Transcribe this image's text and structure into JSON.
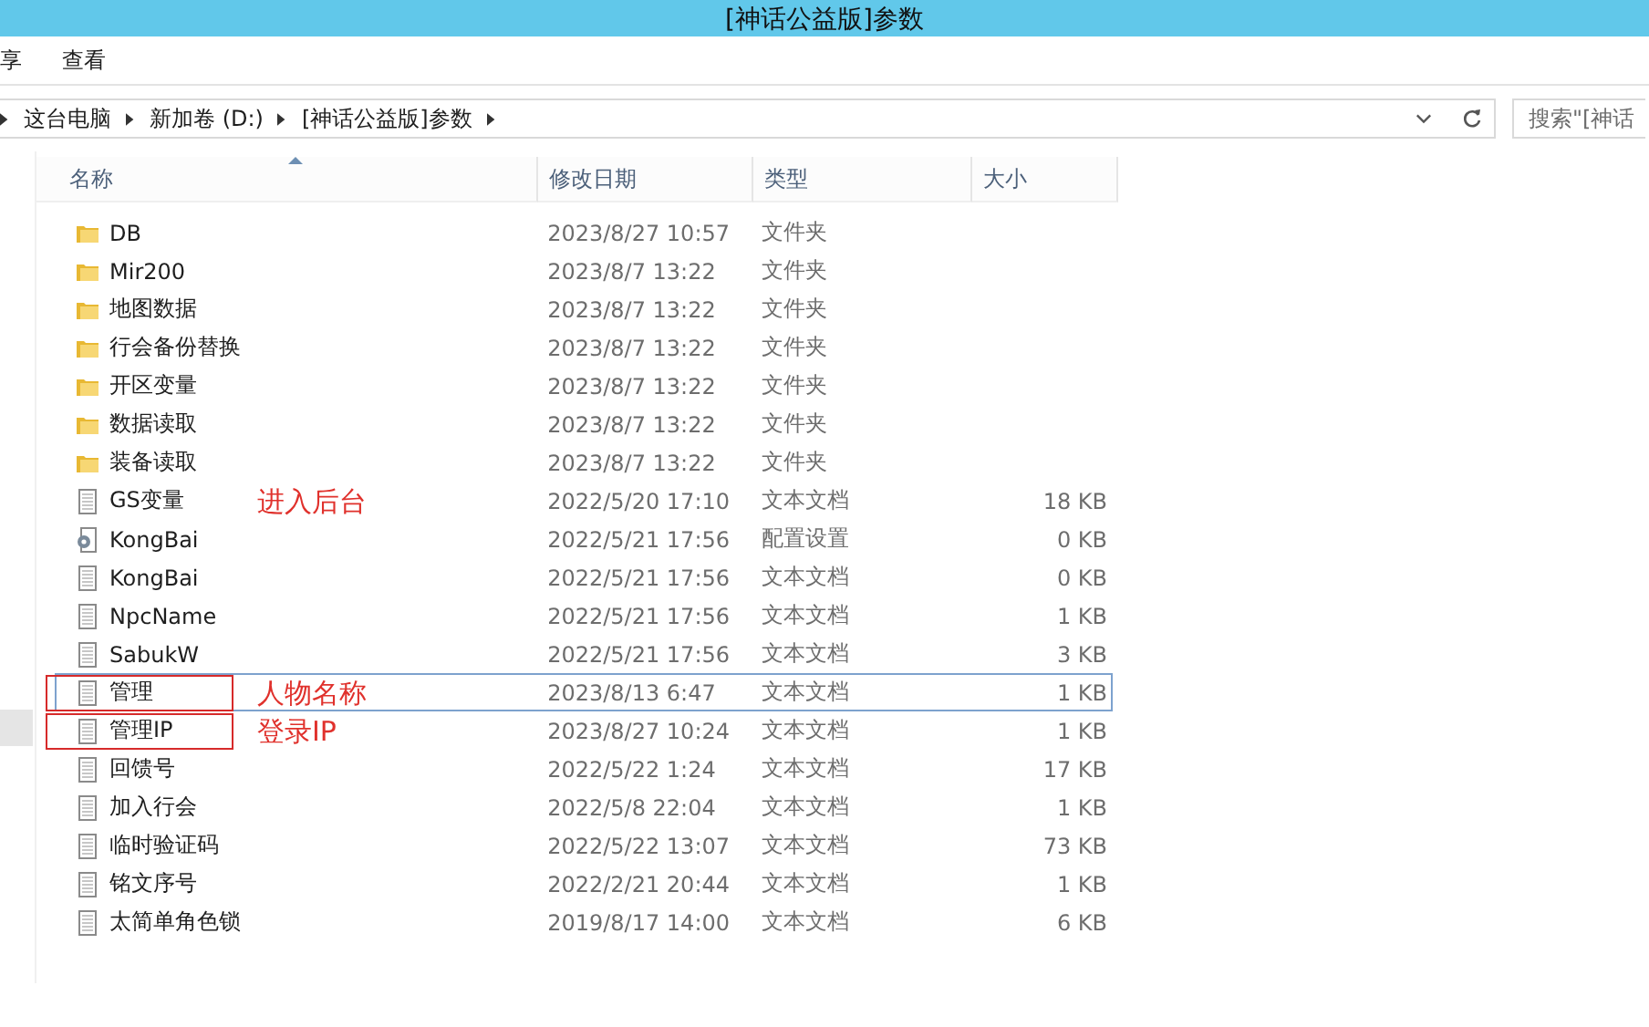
{
  "window": {
    "title": "[神话公益版]参数"
  },
  "menu": [
    {
      "label": "享"
    },
    {
      "label": "查看"
    }
  ],
  "address": {
    "crumbs": [
      "这台电脑",
      "新加卷 (D:)",
      "[神话公益版]参数"
    ]
  },
  "search": {
    "placeholder": "搜索\"[神话"
  },
  "table": {
    "columns": [
      "名称",
      "修改日期",
      "类型",
      "大小"
    ],
    "rows": [
      {
        "name": "DB",
        "date": "2023/8/27 10:57",
        "type": "文件夹",
        "size": "",
        "kind": "folder",
        "selected": false,
        "outlined": false
      },
      {
        "name": "Mir200",
        "date": "2023/8/7 13:22",
        "type": "文件夹",
        "size": "",
        "kind": "folder",
        "selected": false,
        "outlined": false
      },
      {
        "name": "地图数据",
        "date": "2023/8/7 13:22",
        "type": "文件夹",
        "size": "",
        "kind": "folder",
        "selected": false,
        "outlined": false
      },
      {
        "name": "行会备份替换",
        "date": "2023/8/7 13:22",
        "type": "文件夹",
        "size": "",
        "kind": "folder",
        "selected": false,
        "outlined": false
      },
      {
        "name": "开区变量",
        "date": "2023/8/7 13:22",
        "type": "文件夹",
        "size": "",
        "kind": "folder",
        "selected": false,
        "outlined": false
      },
      {
        "name": "数据读取",
        "date": "2023/8/7 13:22",
        "type": "文件夹",
        "size": "",
        "kind": "folder",
        "selected": false,
        "outlined": false
      },
      {
        "name": "装备读取",
        "date": "2023/8/7 13:22",
        "type": "文件夹",
        "size": "",
        "kind": "folder",
        "selected": false,
        "outlined": false
      },
      {
        "name": "GS变量",
        "date": "2022/5/20 17:10",
        "type": "文本文档",
        "size": "18 KB",
        "kind": "text",
        "selected": false,
        "outlined": false,
        "note": "进入后台"
      },
      {
        "name": "KongBai",
        "date": "2022/5/21 17:56",
        "type": "配置设置",
        "size": "0 KB",
        "kind": "config",
        "selected": false,
        "outlined": false
      },
      {
        "name": "KongBai",
        "date": "2022/5/21 17:56",
        "type": "文本文档",
        "size": "0 KB",
        "kind": "text",
        "selected": false,
        "outlined": false
      },
      {
        "name": "NpcName",
        "date": "2022/5/21 17:56",
        "type": "文本文档",
        "size": "1 KB",
        "kind": "text",
        "selected": false,
        "outlined": false
      },
      {
        "name": "SabukW",
        "date": "2022/5/21 17:56",
        "type": "文本文档",
        "size": "3 KB",
        "kind": "text",
        "selected": false,
        "outlined": false
      },
      {
        "name": "管理",
        "date": "2023/8/13 6:47",
        "type": "文本文档",
        "size": "1 KB",
        "kind": "text",
        "selected": true,
        "outlined": true,
        "note": "人物名称"
      },
      {
        "name": "管理IP",
        "date": "2023/8/27 10:24",
        "type": "文本文档",
        "size": "1 KB",
        "kind": "text",
        "selected": false,
        "outlined": true,
        "note": "登录IP"
      },
      {
        "name": "回馈号",
        "date": "2022/5/22 1:24",
        "type": "文本文档",
        "size": "17 KB",
        "kind": "text",
        "selected": false,
        "outlined": false
      },
      {
        "name": "加入行会",
        "date": "2022/5/8 22:04",
        "type": "文本文档",
        "size": "1 KB",
        "kind": "text",
        "selected": false,
        "outlined": false
      },
      {
        "name": "临时验证码",
        "date": "2022/5/22 13:07",
        "type": "文本文档",
        "size": "73 KB",
        "kind": "text",
        "selected": false,
        "outlined": false
      },
      {
        "name": "铭文序号",
        "date": "2022/2/21 20:44",
        "type": "文本文档",
        "size": "1 KB",
        "kind": "text",
        "selected": false,
        "outlined": false
      },
      {
        "name": "太简单角色锁",
        "date": "2019/8/17 14:00",
        "type": "文本文档",
        "size": "6 KB",
        "kind": "text",
        "selected": false,
        "outlined": false
      }
    ]
  }
}
